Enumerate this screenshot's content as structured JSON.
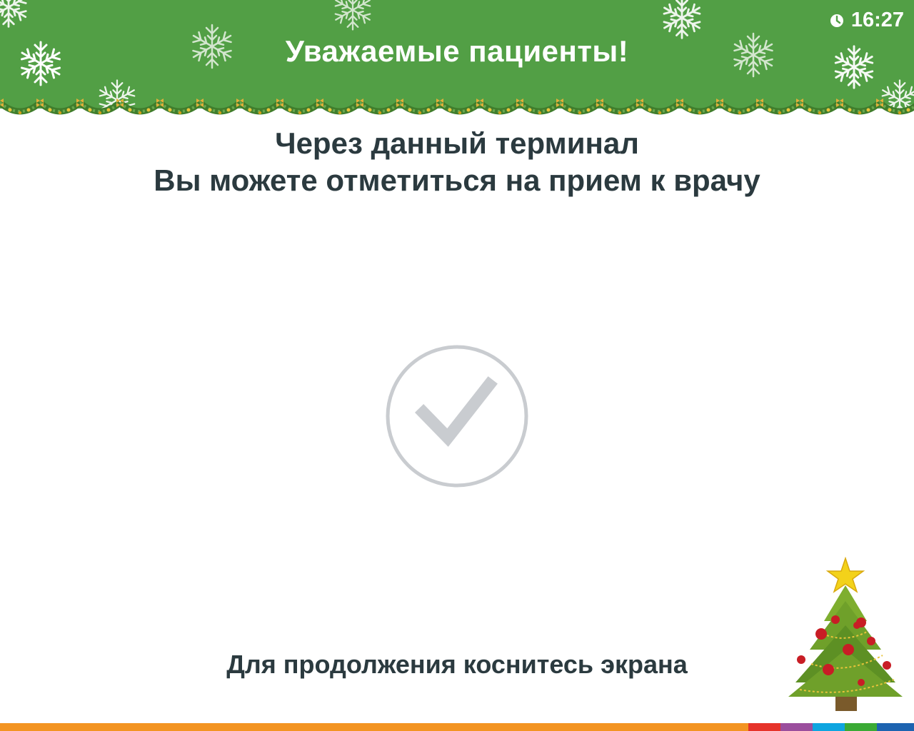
{
  "header": {
    "title": "Уважаемые пациенты!",
    "background_color": "#529f45"
  },
  "clock": {
    "time": "16:27",
    "icon": "clock-icon"
  },
  "main": {
    "headline_line1": "Через данный терминал",
    "headline_line2": "Вы можете отметиться на прием к врачу",
    "confirm_icon": "checkmark-circle-icon",
    "hint": "Для продолжения коснитесь экрана"
  },
  "decorations": {
    "snowflake_icon": "snowflake-icon",
    "garland_icon": "christmas-garland-icon",
    "tree_icon": "christmas-tree-icon"
  },
  "colors": {
    "text": "#2b3a3f",
    "check": "#c9ccd0",
    "bar_main": "#f39422",
    "bar_red": "#e6332a",
    "bar_purple": "#9b4e9d",
    "bar_blue": "#0ea5e0",
    "bar_green": "#3aaa35",
    "bar_darkblue": "#1d63b0"
  }
}
